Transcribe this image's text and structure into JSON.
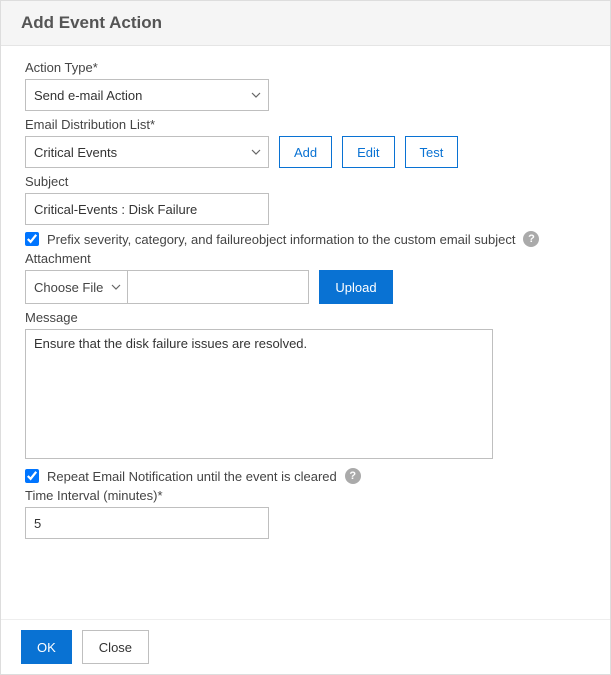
{
  "header": {
    "title": "Add Event Action"
  },
  "actionType": {
    "label": "Action Type*",
    "value": "Send e-mail Action"
  },
  "emailList": {
    "label": "Email Distribution List*",
    "value": "Critical Events",
    "addLabel": "Add",
    "editLabel": "Edit",
    "testLabel": "Test"
  },
  "subject": {
    "label": "Subject",
    "value": "Critical-Events : Disk Failure"
  },
  "prefixCheckbox": {
    "checked": true,
    "label": "Prefix severity, category, and failureobject information to the custom email subject"
  },
  "attachment": {
    "label": "Attachment",
    "chooseLabel": "Choose File",
    "fileName": "",
    "uploadLabel": "Upload"
  },
  "message": {
    "label": "Message",
    "value": "Ensure that the disk failure issues are resolved."
  },
  "repeatCheckbox": {
    "checked": true,
    "label": "Repeat Email Notification until the event is cleared"
  },
  "timeInterval": {
    "label": "Time Interval (minutes)*",
    "value": "5"
  },
  "footer": {
    "okLabel": "OK",
    "closeLabel": "Close"
  }
}
